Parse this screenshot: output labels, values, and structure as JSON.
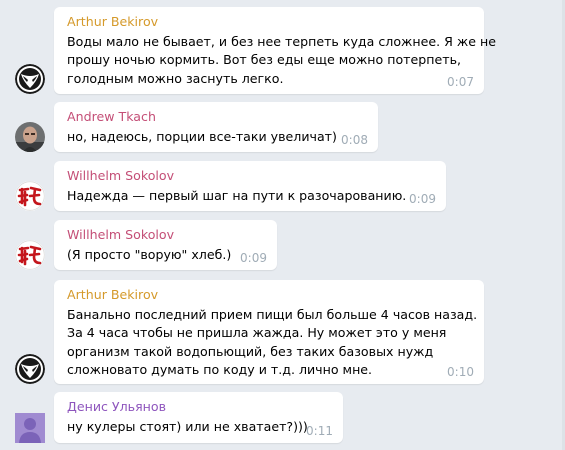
{
  "colors": {
    "chat_background": "#e7ebf0",
    "bubble": "#ffffff",
    "timestamp": "#a0acb6",
    "author_orange": "#d59a2b",
    "author_pink": "#c44f77",
    "author_purple": "#8e55bd"
  },
  "messages": [
    {
      "author": "Arthur Bekirov",
      "avatar_icon": "alien-logo-icon",
      "lines": [
        "Воды мало не бывает, и без нее терпеть куда сложнее. Я же не",
        "прошу ночью кормить. Вот без еды еще можно потерпеть,",
        "голодным можно заснуть легко."
      ],
      "time": "0:07"
    },
    {
      "author": "Andrew Tkach",
      "avatar_icon": "person-photo-icon",
      "lines": [
        "но, надеюсь, порции все-таки увеличат)"
      ],
      "time": "0:08"
    },
    {
      "author": "Willhelm Sokolov",
      "avatar_icon": "red-hieroglyph-icon",
      "lines": [
        "Надежда — первый шаг на пути к разочарованию."
      ],
      "time": "0:09"
    },
    {
      "author": "Willhelm Sokolov",
      "avatar_icon": "red-hieroglyph-icon",
      "lines": [
        "(Я просто \"ворую\" хлеб.)"
      ],
      "time": "0:09"
    },
    {
      "author": "Arthur Bekirov",
      "avatar_icon": "alien-logo-icon",
      "lines": [
        "Банально последний прием пищи был больше 4 часов назад.",
        "За 4 часа чтобы не пришла жажда. Ну может это у меня",
        "организм такой водопьющий, без таких базовых нужд",
        "сложновато думать по коду и т.д. лично мне."
      ],
      "time": "0:10"
    },
    {
      "author": "Денис Ульянов",
      "avatar_icon": "default-user-icon",
      "lines": [
        "ну кулеры стоят) или не хватает?)))"
      ],
      "time": "0:11"
    }
  ]
}
